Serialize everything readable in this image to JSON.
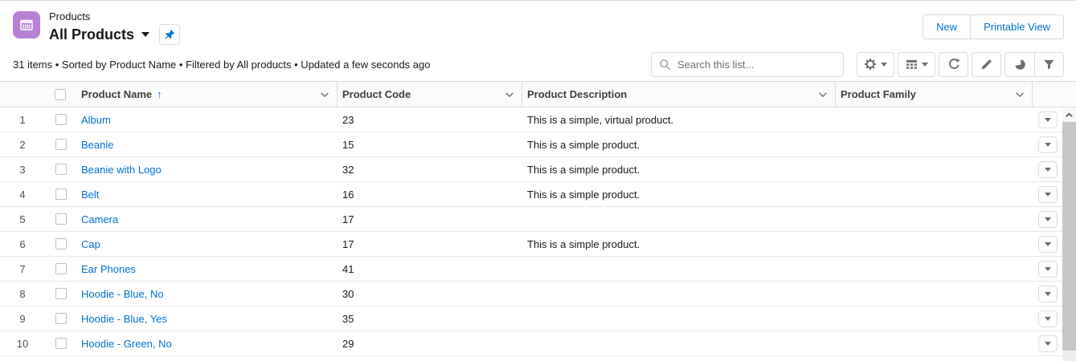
{
  "header": {
    "object_label": "Products",
    "list_view_title": "All Products",
    "actions": {
      "new_label": "New",
      "printable_view_label": "Printable View"
    }
  },
  "status_line": {
    "text": "31 items • Sorted by Product Name • Filtered by All products • Updated a few seconds ago"
  },
  "toolbar": {
    "search_placeholder": "Search this list..."
  },
  "table": {
    "sort_indicator": "↑",
    "columns": {
      "name": "Product Name",
      "code": "Product Code",
      "description": "Product Description",
      "family": "Product Family"
    },
    "rows": [
      {
        "num": "1",
        "name": "Album",
        "code": "23",
        "description": "This is a simple, virtual product.",
        "family": ""
      },
      {
        "num": "2",
        "name": "Beanie",
        "code": "15",
        "description": "This is a simple product.",
        "family": ""
      },
      {
        "num": "3",
        "name": "Beanie with Logo",
        "code": "32",
        "description": "This is a simple product.",
        "family": ""
      },
      {
        "num": "4",
        "name": "Belt",
        "code": "16",
        "description": "This is a simple product.",
        "family": ""
      },
      {
        "num": "5",
        "name": "Camera",
        "code": "17",
        "description": "",
        "family": ""
      },
      {
        "num": "6",
        "name": "Cap",
        "code": "17",
        "description": "This is a simple product.",
        "family": ""
      },
      {
        "num": "7",
        "name": "Ear Phones",
        "code": "41",
        "description": "",
        "family": ""
      },
      {
        "num": "8",
        "name": "Hoodie - Blue, No",
        "code": "30",
        "description": "",
        "family": ""
      },
      {
        "num": "9",
        "name": "Hoodie - Blue, Yes",
        "code": "35",
        "description": "",
        "family": ""
      },
      {
        "num": "10",
        "name": "Hoodie - Green, No",
        "code": "29",
        "description": "",
        "family": ""
      }
    ]
  },
  "icons": {
    "products_object": "crate-icon",
    "pin": "pushpin-icon",
    "search": "magnifier-icon",
    "list_controls": "gear-icon",
    "display_as": "table-grid-icon",
    "refresh": "refresh-icon",
    "edit": "pencil-icon",
    "charts": "pie-chart-icon",
    "filter": "funnel-icon"
  },
  "colors": {
    "link_blue": "#0070d2",
    "sort_arrow_blue": "#0176d3",
    "object_icon_purple": "#b781d3",
    "border_gray": "#dddbda",
    "icon_gray": "#706e6b",
    "text_dark": "#181818"
  }
}
